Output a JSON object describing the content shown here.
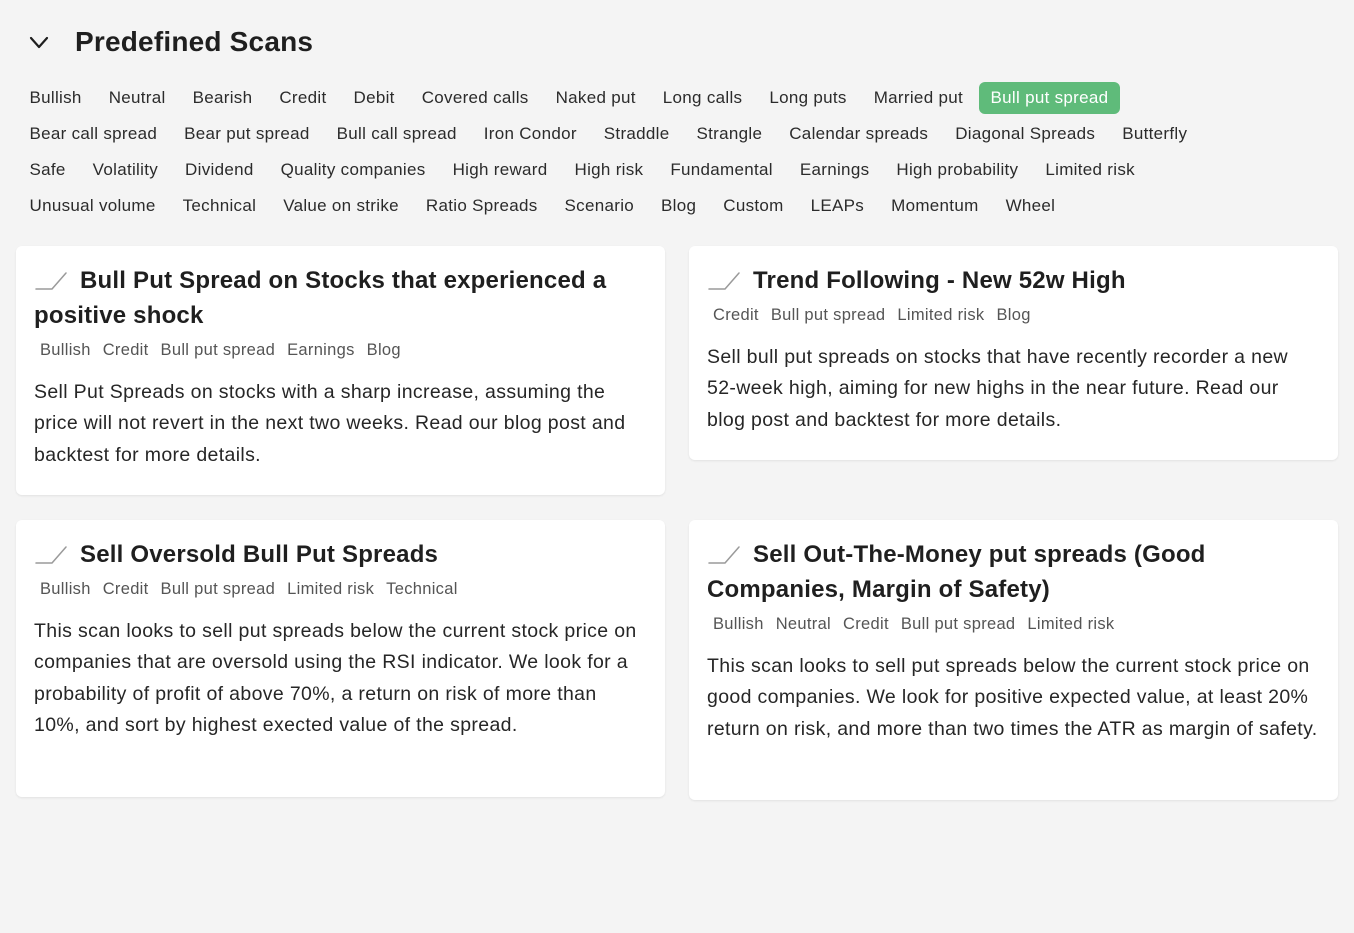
{
  "header": {
    "title": "Predefined Scans",
    "collapse_icon": "chevron-down-icon"
  },
  "tag_rows": [
    [
      "Bullish",
      "Neutral",
      "Bearish",
      "Credit",
      "Debit",
      "Covered calls",
      "Naked put",
      "Long calls",
      "Long puts",
      "Married put",
      "Bull put spread"
    ],
    [
      "Bear call spread",
      "Bear put spread",
      "Bull call spread",
      "Iron Condor",
      "Straddle",
      "Strangle",
      "Calendar spreads",
      "Diagonal Spreads",
      "Butterfly"
    ],
    [
      "Safe",
      "Volatility",
      "Dividend",
      "Quality companies",
      "High reward",
      "High risk",
      "Fundamental",
      "Earnings",
      "High probability",
      "Limited risk"
    ],
    [
      "Unusual volume",
      "Technical",
      "Value on strike",
      "Ratio Spreads",
      "Scenario",
      "Blog",
      "Custom",
      "LEAPs",
      "Momentum",
      "Wheel"
    ]
  ],
  "active_tag": "Bull put spread",
  "accent_color": "#5fbb7a",
  "cards": [
    {
      "icon": "trend-line-icon",
      "title": "Bull Put Spread on Stocks that experienced a positive shock",
      "tags": [
        "Bullish",
        "Credit",
        "Bull put spread",
        "Earnings",
        "Blog"
      ],
      "description": "Sell Put Spreads on stocks with a sharp increase, assuming the price will not revert in the next two weeks. Read our blog post and backtest for more details."
    },
    {
      "icon": "trend-line-icon",
      "title": "Trend Following - New 52w High",
      "tags": [
        "Credit",
        "Bull put spread",
        "Limited risk",
        "Blog"
      ],
      "description": "Sell bull put spreads on stocks that have recently recorder a new 52-week high, aiming for new highs in the near future. Read our blog post and backtest for more details."
    },
    {
      "icon": "trend-line-icon",
      "title": "Sell Oversold Bull Put Spreads",
      "tags": [
        "Bullish",
        "Credit",
        "Bull put spread",
        "Limited risk",
        "Technical"
      ],
      "description": "This scan looks to sell put spreads below the current stock price on companies that are oversold using the RSI indicator. We look for a probability of profit of above 70%, a return on risk of more than 10%, and sort by highest exected value of the spread."
    },
    {
      "icon": "trend-line-icon",
      "title": "Sell Out-The-Money put spreads (Good Companies, Margin of Safety)",
      "tags": [
        "Bullish",
        "Neutral",
        "Credit",
        "Bull put spread",
        "Limited risk"
      ],
      "description": "This scan looks to sell put spreads below the current stock price on good companies. We look for positive expected value, at least 20% return on risk, and more than two times the ATR as margin of safety."
    }
  ]
}
